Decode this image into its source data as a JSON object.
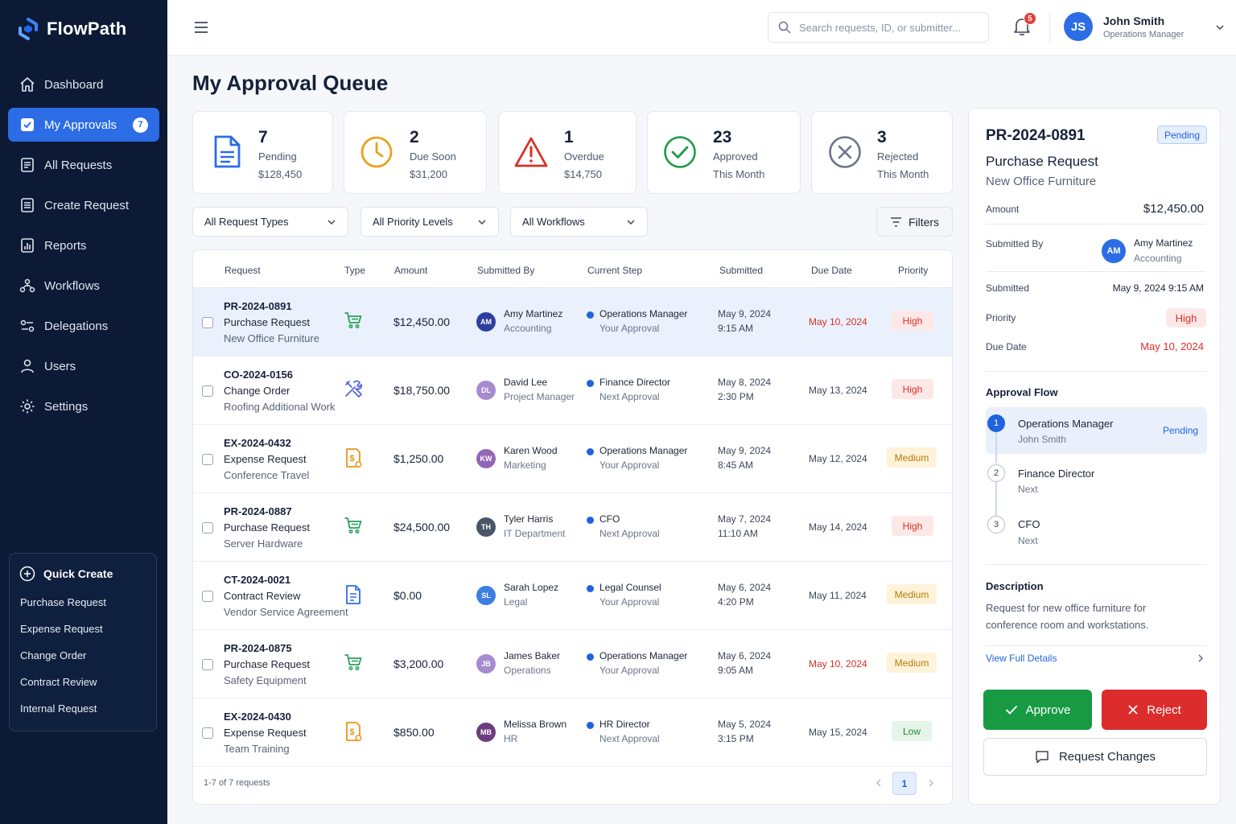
{
  "app": {
    "name": "FlowPath"
  },
  "sidebar": {
    "items": [
      {
        "label": "Dashboard",
        "icon": "home-icon"
      },
      {
        "label": "My Approvals",
        "icon": "approvals-icon",
        "badge": "7",
        "active": true
      },
      {
        "label": "All Requests",
        "icon": "requests-icon"
      },
      {
        "label": "Create Request",
        "icon": "create-icon"
      },
      {
        "label": "Reports",
        "icon": "reports-icon"
      },
      {
        "label": "Workflows",
        "icon": "workflows-icon"
      },
      {
        "label": "Delegations",
        "icon": "delegations-icon"
      },
      {
        "label": "Users",
        "icon": "users-icon"
      },
      {
        "label": "Settings",
        "icon": "settings-icon"
      }
    ],
    "quick_create": {
      "title": "Quick Create",
      "items": [
        "Purchase Request",
        "Expense Request",
        "Change Order",
        "Contract Review",
        "Internal Request"
      ]
    }
  },
  "header": {
    "search_placeholder": "Search requests, ID, or submitter...",
    "notifications": "5",
    "user": {
      "initials": "JS",
      "name": "John Smith",
      "role": "Operations Manager"
    }
  },
  "page": {
    "title": "My Approval Queue"
  },
  "stats": [
    {
      "value": "7",
      "label": "Pending",
      "sub": "$128,450",
      "icon": "document-icon",
      "color": "#2c6de6"
    },
    {
      "value": "2",
      "label": "Due Soon",
      "sub": "$31,200",
      "icon": "clock-icon",
      "color": "#e9a21a"
    },
    {
      "value": "1",
      "label": "Overdue",
      "sub": "$14,750",
      "icon": "warning-icon",
      "color": "#d93025"
    },
    {
      "value": "23",
      "label": "Approved",
      "sub": "This Month",
      "icon": "check-circle-icon",
      "color": "#1e9a4a"
    },
    {
      "value": "3",
      "label": "Rejected",
      "sub": "This Month",
      "icon": "x-circle-icon",
      "color": "#6b7588"
    }
  ],
  "filters": {
    "request_types": "All Request Types",
    "priority_levels": "All Priority Levels",
    "workflows": "All Workflows",
    "button": "Filters"
  },
  "table": {
    "columns": [
      "Request",
      "Type",
      "Amount",
      "Submitted By",
      "Current Step",
      "Submitted",
      "Due Date",
      "Priority"
    ],
    "rows": [
      {
        "id": "PR-2024-0891",
        "type": "Purchase Request",
        "desc": "New Office Furniture",
        "icon": "cart-icon",
        "amount": "$12,450.00",
        "initials": "AM",
        "av_color": "#2f3e9e",
        "name": "Amy Martinez",
        "dept": "Accounting",
        "step": "Operations Manager",
        "step_sub": "Your Approval",
        "date": "May 9, 2024",
        "time": "9:15 AM",
        "due": "May 10, 2024",
        "due_red": true,
        "priority": "High",
        "selected": true
      },
      {
        "id": "CO-2024-0156",
        "type": "Change Order",
        "desc": "Roofing Additional Work",
        "icon": "tools-icon",
        "amount": "$18,750.00",
        "initials": "DL",
        "av_color": "#a78bcf",
        "name": "David Lee",
        "dept": "Project Manager",
        "step": "Finance Director",
        "step_sub": "Next Approval",
        "date": "May 8, 2024",
        "time": "2:30 PM",
        "due": "May 13, 2024",
        "due_red": false,
        "priority": "High"
      },
      {
        "id": "EX-2024-0432",
        "type": "Expense Request",
        "desc": "Conference Travel",
        "icon": "receipt-icon",
        "amount": "$1,250.00",
        "initials": "KW",
        "av_color": "#9367b8",
        "name": "Karen Wood",
        "dept": "Marketing",
        "step": "Operations Manager",
        "step_sub": "Your Approval",
        "date": "May 9, 2024",
        "time": "8:45 AM",
        "due": "May 12, 2024",
        "due_red": false,
        "priority": "Medium"
      },
      {
        "id": "PR-2024-0887",
        "type": "Purchase Request",
        "desc": "Server Hardware",
        "icon": "cart-icon",
        "amount": "$24,500.00",
        "initials": "TH",
        "av_color": "#4a5568",
        "name": "Tyler Harris",
        "dept": "IT Department",
        "step": "CFO",
        "step_sub": "Next Approval",
        "date": "May 7, 2024",
        "time": "11:10 AM",
        "due": "May 14, 2024",
        "due_red": false,
        "priority": "High"
      },
      {
        "id": "CT-2024-0021",
        "type": "Contract Review",
        "desc": "Vendor Service Agreement",
        "icon": "contract-icon",
        "amount": "$0.00",
        "initials": "SL",
        "av_color": "#3d7fe0",
        "name": "Sarah Lopez",
        "dept": "Legal",
        "step": "Legal Counsel",
        "step_sub": "Your Approval",
        "date": "May 6, 2024",
        "time": "4:20 PM",
        "due": "May 11, 2024",
        "due_red": false,
        "priority": "Medium"
      },
      {
        "id": "PR-2024-0875",
        "type": "Purchase Request",
        "desc": "Safety Equipment",
        "icon": "cart-icon",
        "amount": "$3,200.00",
        "initials": "JB",
        "av_color": "#a78bcf",
        "name": "James Baker",
        "dept": "Operations",
        "step": "Operations Manager",
        "step_sub": "Your Approval",
        "date": "May 6, 2024",
        "time": "9:05 AM",
        "due": "May 10, 2024",
        "due_red": true,
        "priority": "Medium"
      },
      {
        "id": "EX-2024-0430",
        "type": "Expense Request",
        "desc": "Team Training",
        "icon": "receipt-icon",
        "amount": "$850.00",
        "initials": "MB",
        "av_color": "#6b3d7e",
        "name": "Melissa Brown",
        "dept": "HR",
        "step": "HR Director",
        "step_sub": "Next Approval",
        "date": "May 5, 2024",
        "time": "3:15 PM",
        "due": "May 15, 2024",
        "due_red": false,
        "priority": "Low"
      }
    ],
    "footer": "1-7 of 7 requests",
    "page": "1"
  },
  "detail": {
    "id": "PR-2024-0891",
    "status": "Pending",
    "type": "Purchase Request",
    "desc": "New Office Furniture",
    "amount_label": "Amount",
    "amount": "$12,450.00",
    "submitted_by_label": "Submitted By",
    "submitter_initials": "AM",
    "submitter_name": "Amy Martinez",
    "submitter_dept": "Accounting",
    "submitted_label": "Submitted",
    "submitted": "May 9, 2024 9:15 AM",
    "priority_label": "Priority",
    "priority": "High",
    "due_label": "Due Date",
    "due": "May 10, 2024",
    "flow_title": "Approval Flow",
    "flow": [
      {
        "num": "1",
        "title": "Operations Manager",
        "sub": "John Smith",
        "status": "Pending"
      },
      {
        "num": "2",
        "title": "Finance Director",
        "sub": "Next"
      },
      {
        "num": "3",
        "title": "CFO",
        "sub": "Next"
      }
    ],
    "description_title": "Description",
    "description": "Request for new office furniture for conference room and workstations.",
    "view_link": "View Full Details",
    "approve": "Approve",
    "reject": "Reject",
    "request_changes": "Request Changes"
  }
}
